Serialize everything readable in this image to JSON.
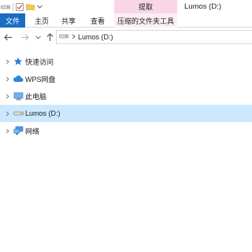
{
  "window": {
    "title": "Lumos (D:)",
    "context_tab_label": "提取"
  },
  "quick_access_toolbar": {
    "items": [
      "drive-icon",
      "properties-icon",
      "new-folder-icon",
      "dropdown-icon"
    ]
  },
  "ribbon": {
    "tabs": [
      {
        "label": "文件"
      },
      {
        "label": "主页"
      },
      {
        "label": "共享"
      },
      {
        "label": "查看"
      },
      {
        "label": "压缩的文件夹工具"
      }
    ]
  },
  "address_bar": {
    "path": "Lumos (D:)"
  },
  "nav_pane": {
    "items": [
      {
        "label": "快速访问",
        "icon": "star-pin-icon"
      },
      {
        "label": "WPS网盘",
        "icon": "cloud-icon"
      },
      {
        "label": "此电脑",
        "icon": "computer-icon"
      },
      {
        "label": "Lumos (D:)",
        "icon": "drive-icon"
      },
      {
        "label": "网络",
        "icon": "network-icon"
      }
    ]
  },
  "colors": {
    "file_tab": "#1a6dc2",
    "context_tab": "#f8d6e8",
    "selected_row": "#cce8ff",
    "star": "#2b7fd9"
  }
}
